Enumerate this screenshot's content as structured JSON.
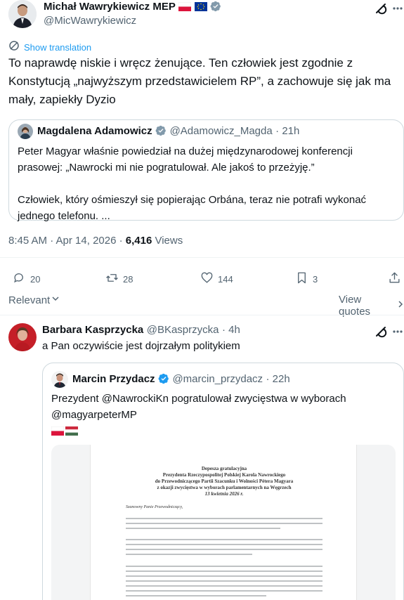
{
  "main_tweet": {
    "author_name": "Michał Wawrykiewicz MEP",
    "handle": "@MicWawrykiewicz",
    "show_translation": "Show translation",
    "text_line1": "To naprawdę niskie i wręcz żenujące. Ten człowiek jest zgodnie z",
    "text_line2": "Konstytucją „najwyższym przedstawicielem RP”, a zachowuje się jak ma",
    "text_line3": "mały, zapiekły Dyzio",
    "timestamp": "8:45 AM · Apr 14, 2026 · ",
    "views_count": "6,416",
    "views_label": " Views"
  },
  "quoted_tweet_1": {
    "author_name": "Magdalena Adamowicz",
    "handle": "@Adamowicz_Magda",
    "time": "· 21h",
    "line1": "Peter Magyar właśnie powiedział na dużej międzynarodowej konferencji",
    "line2": "prasowej: „Nawrocki mi nie pogratulował. Ale jakoś to przeżyję.”",
    "line3": "Człowiek, który ośmieszył się popierając Orbána, teraz nie potrafi wykonać",
    "line4": "jednego telefonu. ..."
  },
  "actions": {
    "replies": "20",
    "reposts": "28",
    "likes": "144",
    "bookmarks": "3"
  },
  "sort": {
    "relevant_label": "Relevant",
    "view_quotes_label": "View quotes"
  },
  "reply": {
    "author_name": "Barbara Kasprzycka",
    "handle": "@BKasprzycka",
    "time": "· 4h",
    "text": "a Pan oczywiście jest dojrzałym politykiem"
  },
  "quoted_tweet_2": {
    "author_name": "Marcin Przydacz",
    "handle": "@marcin_przydacz",
    "time": "· 22h",
    "line1": "Prezydent @NawrockiKn pogratulował zwycięstwa w wyborach",
    "line2": "@magyarpeterMP"
  },
  "document": {
    "title": "Depesza gratulacyjna",
    "subtitle1": "Prezydenta Rzeczypospolitej Polskiej Karola Nawrockiego",
    "subtitle2": "do Przewodniczącego Partii Szacunku i Wolności Pétera Magyara",
    "subtitle3": "z okazji zwycięstwa w wyborach parlamentarnych na Węgrzech",
    "date": "13 kwietnia 2026 r.",
    "greeting": "Szanowny Panie Przewodniczący,"
  },
  "colors": {
    "accent": "#1d9bf0",
    "text": "#0f1419",
    "muted": "#536471",
    "border": "#cfd9de"
  },
  "icons": [
    "grok-icon",
    "verified-badge-icon",
    "translate-icon",
    "reply-icon",
    "repost-icon",
    "like-icon",
    "bookmark-icon",
    "share-icon",
    "chevron-down-icon",
    "chevron-right-icon"
  ]
}
